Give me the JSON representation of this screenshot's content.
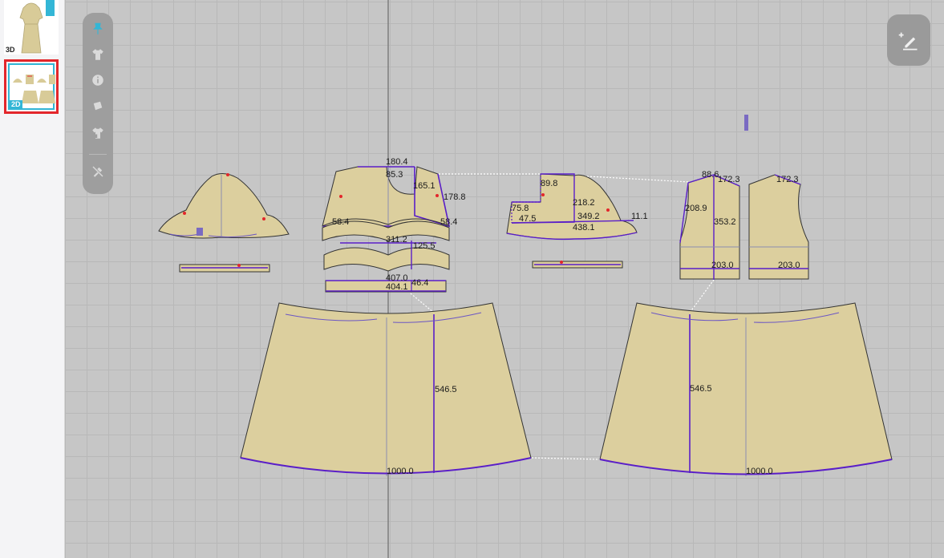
{
  "sidebar": {
    "thumb_3d_label": "3D",
    "thumb_2d_label": "2D"
  },
  "toolbar": {
    "tools": [
      "pin-icon",
      "garment-icon",
      "info-icon",
      "fabric-icon",
      "lock-garment-icon",
      "hide-icon"
    ]
  },
  "fab": {
    "icon": "edit-add-icon"
  },
  "measurements": {
    "m1": "180.4",
    "m2": "85.3",
    "m3": "165.1",
    "m4": "178.8",
    "m5": "58.4",
    "m6": "58.4",
    "m7": "311.2",
    "m8": "125.5",
    "m9": "407.0",
    "m10": "404.1",
    "m11": "46.4",
    "m12": "89.8",
    "m13": "218.2",
    "m14": "75.8",
    "m15": "47.5",
    "m16": "349.2",
    "m17": "438.1",
    "m18": "11.1",
    "m19": "88.6",
    "m20": "172.3",
    "m21": "172.3",
    "m22": "208.9",
    "m23": "353.2",
    "m24": "203.0",
    "m25": "203.0",
    "m26": "546.5",
    "m27": "546.5",
    "m28": "1000.0",
    "m29": "1000.0"
  },
  "colors": {
    "fabric": "#dccf9e",
    "seam": "#5a1ec8",
    "accent": "#33b6d6",
    "selection": "#e3262b"
  }
}
